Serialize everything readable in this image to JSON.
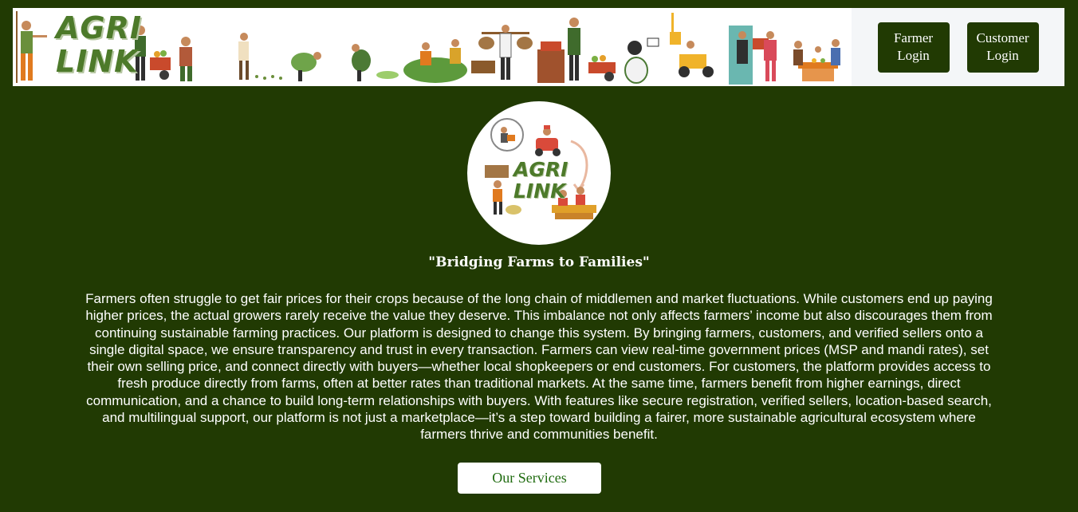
{
  "header": {
    "banner_logo_line1": "AGRI",
    "banner_logo_line2": "LINK",
    "farmer_login_label": "Farmer Login",
    "customer_login_label": "Customer Login"
  },
  "hero": {
    "logo_line1": "AGRI",
    "logo_line2": "LINK",
    "tagline": "\"Bridging Farms to Families\"",
    "description": "Farmers often struggle to get fair prices for their crops because of the long chain of middlemen and market fluctuations. While customers end up paying higher prices, the actual growers rarely receive the value they deserve. This imbalance not only affects farmers’ income but also discourages them from continuing sustainable farming practices. Our platform is designed to change this system. By bringing farmers, customers, and verified sellers onto a single digital space, we ensure transparency and trust in every transaction. Farmers can view real-time government prices (MSP and mandi rates), set their own selling price, and connect directly with buyers—whether local shopkeepers or end customers. For customers, the platform provides access to fresh produce directly from farms, often at better rates than traditional markets. At the same time, farmers benefit from higher earnings, direct communication, and a chance to build long-term relationships with buyers. With features like secure registration, verified sellers, location-based search, and multilingual support, our platform is not just a marketplace—it’s a step toward building a fairer, more sustainable agricultural ecosystem where farmers thrive and communities benefit.",
    "services_label": "Our Services"
  },
  "colors": {
    "background": "#213a03",
    "button_bg": "#213a03",
    "logo_green": "#4d7a2a",
    "services_text": "#1f6b0f"
  }
}
